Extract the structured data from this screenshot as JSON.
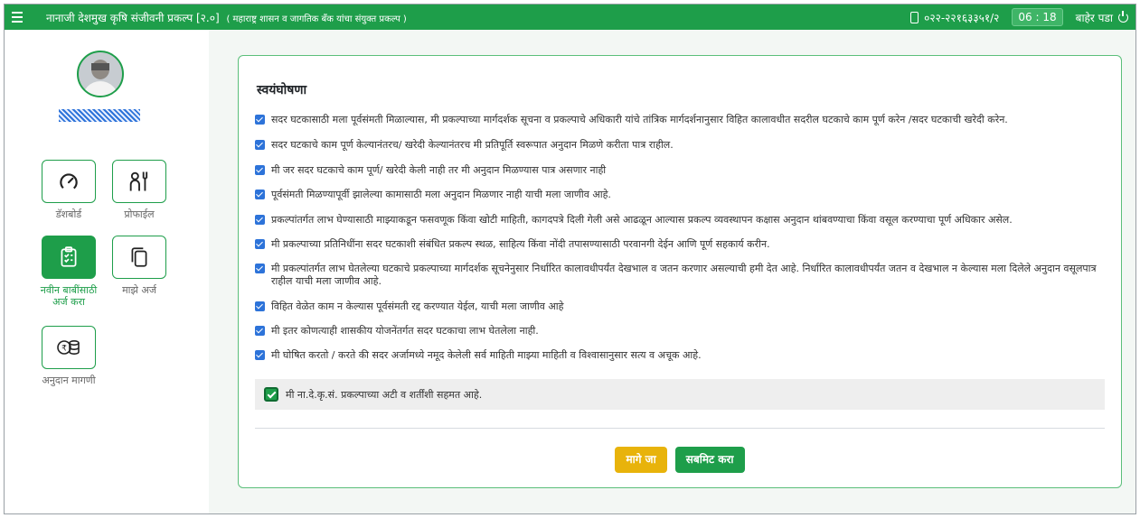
{
  "header": {
    "title": "नानाजी देशमुख कृषि संजीवनी प्रकल्प [२.०]",
    "subtitle": "( महाराष्ट्र शासन व जागतिक बँक यांचा संयुक्त प्रकल्प )",
    "phone": "०२२-२२१६३३५१/२",
    "timer": "06 : 18",
    "logout_label": "बाहेर पडा",
    "icons": [
      "menu-icon",
      "phone-icon",
      "power-icon"
    ]
  },
  "sidebar": {
    "items": [
      {
        "label": "डॅशबोर्ड",
        "icon": "gauge-icon"
      },
      {
        "label": "प्रोफाईल",
        "icon": "utensils-icon"
      },
      {
        "label": "नवीन बाबींसाठी अर्ज करा",
        "icon": "clipboard-check-icon",
        "active": true
      },
      {
        "label": "माझे अर्ज",
        "icon": "copy-icon"
      },
      {
        "label": "अनुदान मागणी",
        "icon": "coins-icon"
      }
    ]
  },
  "declaration": {
    "title": "स्वयंघोषणा",
    "items": [
      "सदर घटकासाठी मला पूर्वसंमती मिळाल्यास, मी प्रकल्पाच्या मार्गदर्शक सूचना व प्रकल्पाचे अधिकारी यांचे तांत्रिक मार्गदर्शनानुसार विहित कालावधीत सदरील घटकाचे काम पूर्ण करेन /सदर घटकाची खरेदी करेन.",
      "सदर घटकाचे काम पूर्ण केल्यानंतरच/ खरेदी केल्यानंतरच मी प्रतिपूर्ति स्वरूपात अनुदान मिळणे करीता पात्र राहील.",
      "मी जर सदर घटकाचे काम पूर्ण/ खरेदी केली नाही तर मी अनुदान मिळण्यास पात्र असणार नाही",
      "पूर्वसंमती मिळण्यापूर्वी झालेल्या कामासाठी मला अनुदान मिळणार नाही याची मला जाणीव आहे.",
      "प्रकल्पांतर्गत लाभ घेण्यासाठी माझ्याकडून फसवणूक किंवा खोटी माहिती, कागदपत्रे दिली गेली असे आढळून आल्यास प्रकल्प व्यवस्थापन कक्षास अनुदान थांबवण्याचा किंवा वसूल करण्याचा पूर्ण अधिकार असेल.",
      "मी प्रकल्पाच्या प्रतिनिधींना सदर घटकाशी संबंधित प्रकल्प स्थळ, साहित्य किंवा नोंदी तपासण्यासाठी परवानगी देईन आणि पूर्ण सहकार्य करीन.",
      "मी प्रकल्पांतर्गत लाभ घेतलेल्या घटकाचे प्रकल्पाच्या मार्गदर्शक सूचनेनुसार निर्धारित कालावधीपर्यंत देखभाल व जतन करणार असल्याची हमी देत आहे. निर्धारित कालावधीपर्यंत जतन व देखभाल न केल्यास मला दिलेले अनुदान वसूलपात्र राहील याची मला जाणीव आहे.",
      "विहित वेळेत काम न केल्यास पूर्वसंमती रद्द करण्यात येईल, याची मला जाणीव आहे",
      "मी इतर कोणत्याही शासकीय योजनेंतर्गत सदर घटकाचा लाभ घेतलेला नाही.",
      "मी घोषित करतो / करते की सदर अर्जामध्ये नमूद केलेली सर्व माहिती माझ्या माहिती व विश्वासानुसार सत्य व अचूक आहे."
    ],
    "agree_label": "मी ना.दे.कृ.सं. प्रकल्पाच्या अटी व शर्तींशी सहमत आहे.",
    "back_button": "मागे जा",
    "submit_button": "सबमिट करा"
  },
  "colors": {
    "accent": "#1e9e4a",
    "checkbox": "#2d73d9",
    "back_button": "#e8b30b"
  }
}
